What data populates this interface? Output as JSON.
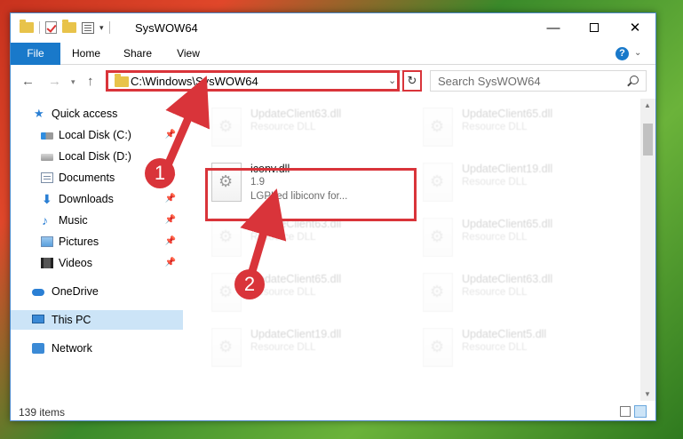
{
  "window": {
    "title": "SysWOW64"
  },
  "ribbon": {
    "tabs": [
      "File",
      "Home",
      "Share",
      "View"
    ]
  },
  "address": {
    "path": "C:\\Windows\\SysWOW64"
  },
  "search": {
    "placeholder": "Search SysWOW64"
  },
  "sidebar": {
    "items": [
      {
        "label": "Quick access",
        "icon": "star-icon",
        "pinned": false
      },
      {
        "label": "Local Disk (C:)",
        "icon": "local-disk-icon",
        "pinned": true
      },
      {
        "label": "Local Disk (D:)",
        "icon": "local-disk-icon",
        "pinned": false
      },
      {
        "label": "Documents",
        "icon": "documents-icon",
        "pinned": true
      },
      {
        "label": "Downloads",
        "icon": "downloads-icon",
        "pinned": true
      },
      {
        "label": "Music",
        "icon": "music-icon",
        "pinned": true
      },
      {
        "label": "Pictures",
        "icon": "pictures-icon",
        "pinned": true
      },
      {
        "label": "Videos",
        "icon": "videos-icon",
        "pinned": true
      },
      {
        "label": "OneDrive",
        "icon": "onedrive-icon",
        "pinned": false
      },
      {
        "label": "This PC",
        "icon": "this-pc-icon",
        "pinned": false,
        "selected": true
      },
      {
        "label": "Network",
        "icon": "network-icon",
        "pinned": false
      }
    ]
  },
  "files": [
    {
      "name": "UpdateClient63.dll",
      "line1": "Resource DLL",
      "line2": ""
    },
    {
      "name": "UpdateClient65.dll",
      "line1": "Resource DLL",
      "line2": ""
    },
    {
      "name": "iconv.dll",
      "line1": "1.9",
      "line2": "LGPLed libiconv for..."
    },
    {
      "name": "UpdateClient19.dll",
      "line1": "Resource DLL",
      "line2": ""
    },
    {
      "name": "UpdateClient63.dll",
      "line1": "Resource DLL",
      "line2": ""
    },
    {
      "name": "UpdateClient65.dll",
      "line1": "Resource DLL",
      "line2": ""
    },
    {
      "name": "UpdateClient65.dll",
      "line1": "Resource DLL",
      "line2": ""
    },
    {
      "name": "UpdateClient63.dll",
      "line1": "Resource DLL",
      "line2": ""
    },
    {
      "name": "UpdateClient19.dll",
      "line1": "Resource DLL",
      "line2": ""
    },
    {
      "name": "UpdateClient5.dll",
      "line1": "Resource DLL",
      "line2": ""
    }
  ],
  "status": {
    "item_count": "139 items"
  },
  "annotations": {
    "step1": "1",
    "step2": "2"
  },
  "colors": {
    "accent": "#1979ca",
    "highlight": "#d9343a",
    "selected": "#cce4f7"
  }
}
